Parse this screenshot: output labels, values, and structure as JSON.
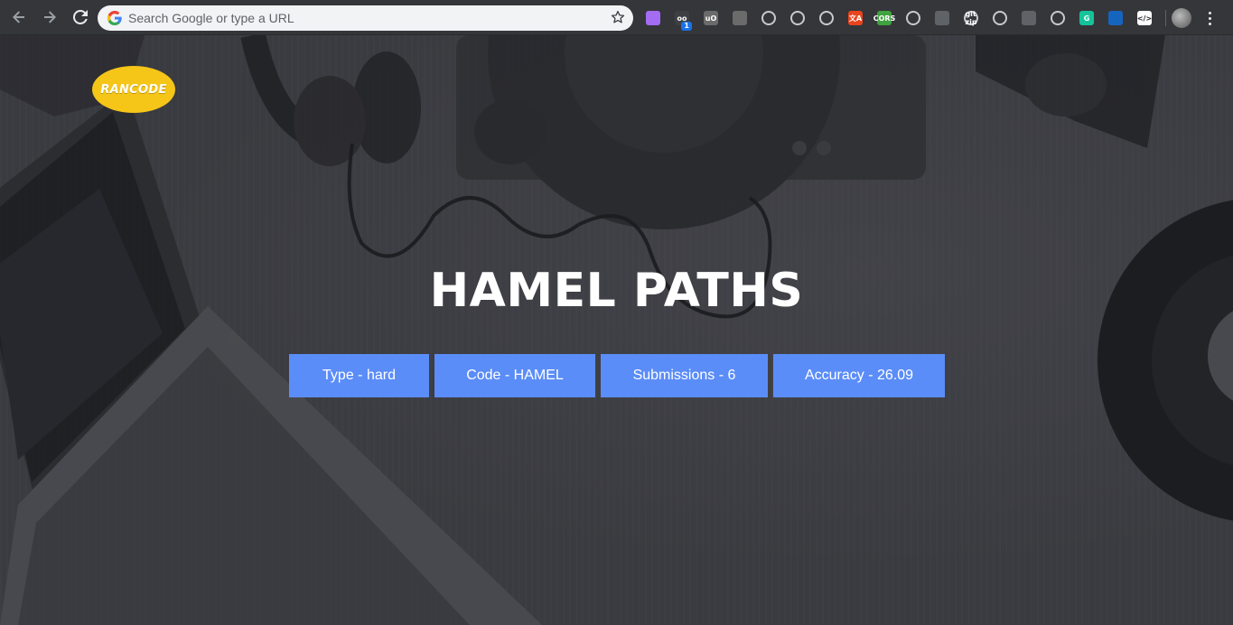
{
  "browser": {
    "omnibox_placeholder": "Search Google or type a URL",
    "extension_badge": "1",
    "extensions": [
      {
        "name": "extension-1-icon",
        "color": "#a36cf2",
        "text": ""
      },
      {
        "name": "extension-2-icon",
        "color": "#3c4043",
        "text": "oo"
      },
      {
        "name": "ublock-icon",
        "color": "#6b6b6b",
        "text": "uO"
      },
      {
        "name": "camera-icon",
        "color": "#6b6b6b",
        "text": ""
      },
      {
        "name": "eyedropper-icon",
        "color": "#35363a",
        "text": ""
      },
      {
        "name": "target-icon",
        "color": "#35363a",
        "text": ""
      },
      {
        "name": "react-icon",
        "color": "#35363a",
        "text": ""
      },
      {
        "name": "translate-icon",
        "color": "#e8441e",
        "text": "文A"
      },
      {
        "name": "cors-icon",
        "color": "#3fa33f",
        "text": "CORS"
      },
      {
        "name": "cookie-icon",
        "color": "#35363a",
        "text": ""
      },
      {
        "name": "download-icon",
        "color": "#5f6368",
        "text": ""
      },
      {
        "name": "git-zip-icon",
        "color": "#35363a",
        "text": "git zip"
      },
      {
        "name": "gear-icon",
        "color": "#35363a",
        "text": ""
      },
      {
        "name": "clock-icon",
        "color": "#5f6368",
        "text": ""
      },
      {
        "name": "mask-icon",
        "color": "#35363a",
        "text": ""
      },
      {
        "name": "grammarly-icon",
        "color": "#15c39a",
        "text": "G"
      },
      {
        "name": "globe-icon",
        "color": "#1565c0",
        "text": ""
      },
      {
        "name": "code-icon",
        "color": "#ffffff",
        "text": "</>"
      }
    ]
  },
  "page": {
    "logo_text": "RANCODE",
    "title": "HAMEL PATHS",
    "stats": [
      {
        "label": "Type - hard"
      },
      {
        "label": "Code - HAMEL"
      },
      {
        "label": "Submissions - 6"
      },
      {
        "label": "Accuracy - 26.09"
      }
    ],
    "accent_color": "#5b8df8",
    "logo_color": "#f5c518"
  }
}
